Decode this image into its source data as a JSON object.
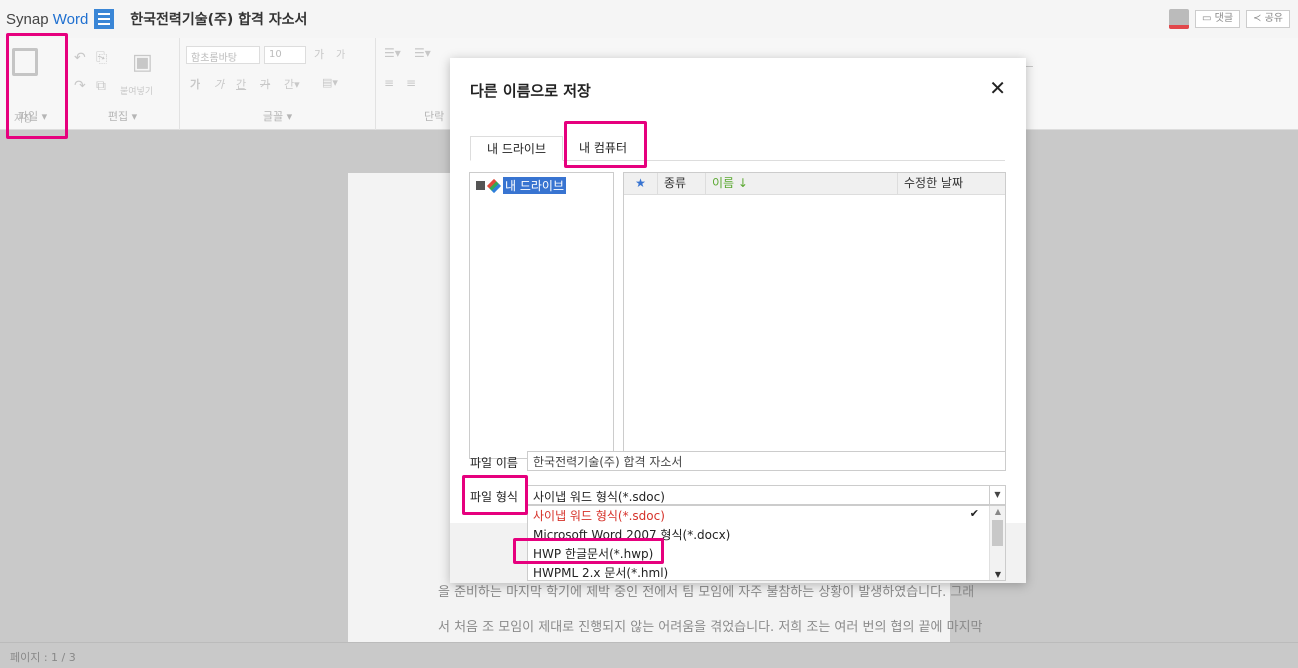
{
  "app": {
    "brand_prefix": "Synap",
    "brand_name": "Word",
    "document_title": "한국전력기술(주) 합격 자소서",
    "comment_label": "댓글",
    "share_label": "공유"
  },
  "toolbar": {
    "save_label": "저장",
    "file_group": "파일 ▾",
    "edit_group": "편집 ▾",
    "font_group": "글꼴 ▾",
    "paragraph_group": "단락",
    "paste_label": "붙여넣기",
    "font_name": "함초롬바탕",
    "font_size": "10"
  },
  "document": {
    "line1": "을 준비하는 마지막 학기에 제박 중인 전에서 팀 모임에 자주 불참하는 상황이 발생하였습니다. 그래",
    "line2": "서 처음 조 모임이 제대로 진행되지 않는 어려움을 겪었습니다. 저희 조는 여러 번의 협의 끝에 마지막"
  },
  "status": {
    "page": "페이지 : 1 / 3"
  },
  "dialog": {
    "title": "다른 이름으로 저장",
    "close": "✕",
    "tabs": [
      "내 드라이브",
      "내 컴퓨터"
    ],
    "tree_root": "내 드라이브",
    "columns": {
      "star": "★",
      "type": "종류",
      "name": "이름 ↓",
      "date": "수정한 날짜"
    },
    "filename_label": "파일 이름",
    "filename_value": "한국전력기술(주) 합격 자소서",
    "format_label": "파일 형식",
    "format_selected": "사이냅 워드 형식(*.sdoc)",
    "format_options": [
      "사이냅 워드 형식(*.sdoc)",
      "Microsoft Word 2007 형식(*.docx)",
      "HWP 한글문서(*.hwp)",
      "HWPML 2.x 문서(*.hml)"
    ]
  },
  "colors": {
    "highlight": "#e6007e",
    "accent": "#3874d1",
    "selected_option": "#d6322a"
  }
}
